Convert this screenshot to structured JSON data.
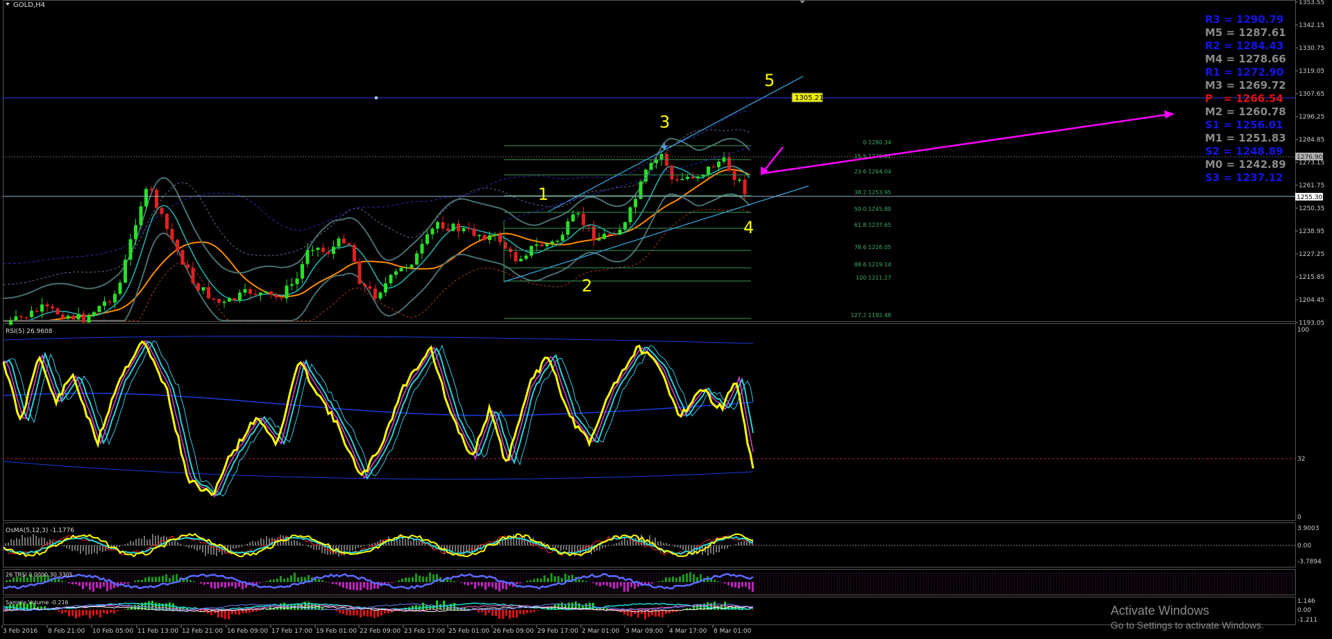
{
  "window": {
    "symbol_label": "GOLD,H4"
  },
  "main_panel": {
    "price_ticks": [
      "1353.55",
      "1342.15",
      "1330.75",
      "1319.05",
      "1307.65",
      "1296.25",
      "1284.85",
      "1273.15",
      "1261.75",
      "1250.35",
      "1238.95",
      "1227.25",
      "1215.85",
      "1204.45",
      "1193.05"
    ],
    "current_price": "1255.30",
    "marked_price_label": "1305.21",
    "top_right_tag": "1276.90",
    "wave_labels": [
      "1",
      "2",
      "3",
      "4",
      "5"
    ],
    "fibonacci": [
      {
        "label": "0 1280.34"
      },
      {
        "label": "15.5 1270.81"
      },
      {
        "label": "23.6 1264.04"
      },
      {
        "label": "38.2 1253.95"
      },
      {
        "label": "50.0 1245.80"
      },
      {
        "label": "61.8 1237.65"
      },
      {
        "label": "78.6 1226.05"
      },
      {
        "label": "88.6 1219.14"
      },
      {
        "label": "100 1211.27"
      },
      {
        "label": "127.2 1192.48"
      }
    ],
    "pivots": [
      {
        "label": "R3 = 1290.79",
        "color": "#1515e6"
      },
      {
        "label": "M5 = 1287.61",
        "color": "#8a8a8a"
      },
      {
        "label": "R2 = 1284.43",
        "color": "#1515e6"
      },
      {
        "label": "M4 = 1278.66",
        "color": "#8a8a8a"
      },
      {
        "label": "R1 = 1272.90",
        "color": "#1515e6"
      },
      {
        "label": "M3 = 1269.72",
        "color": "#8a8a8a"
      },
      {
        "label": "P   = 1266.54",
        "color": "#e01010"
      },
      {
        "label": "M2 = 1260.78",
        "color": "#8a8a8a"
      },
      {
        "label": "S1 = 1256.01",
        "color": "#1515e6"
      },
      {
        "label": "M1 = 1251.83",
        "color": "#8a8a8a"
      },
      {
        "label": "S2 = 1248.89",
        "color": "#1515e6"
      },
      {
        "label": "M0 = 1242.89",
        "color": "#8a8a8a"
      },
      {
        "label": "S3 = 1237.12",
        "color": "#1515e6"
      }
    ]
  },
  "rsi_panel": {
    "title": "RSI(5) 26.9608",
    "ticks": [
      "100",
      "32",
      "0"
    ]
  },
  "osma_panel": {
    "title": "OsMA(5,12,3) -1.1776",
    "ticks": [
      "3.9003",
      "0.00",
      "-3.7894"
    ]
  },
  "tsi_panel": {
    "title": "26 TRSI 0.0000 30.3305"
  },
  "fifth_panel": {
    "title": "Sample Volume -0.216",
    "ticks": [
      "1.146",
      "0.00",
      "-1.211"
    ]
  },
  "time_axis": [
    "3 Feb 2016",
    "8 Feb 21:00",
    "10 Feb 05:00",
    "11 Feb 13:00",
    "12 Feb 21:00",
    "16 Feb 09:00",
    "17 Feb 17:00",
    "19 Feb 01:00",
    "22 Feb 09:00",
    "23 Feb 17:00",
    "25 Feb 01:00",
    "26 Feb 09:00",
    "29 Feb 17:00",
    "2 Mar 01:00",
    "3 Mar 09:00",
    "4 Mar 17:00",
    "8 Mar 01:00"
  ],
  "watermark": {
    "title": "Activate Windows",
    "subtitle": "Go to Settings to activate Windows."
  },
  "colors": {
    "bull": "#28e028",
    "bear": "#e02020",
    "rsi": "#ffff00",
    "pivot_arrow": "#ff00ff",
    "fib": "#3a9a5a"
  }
}
